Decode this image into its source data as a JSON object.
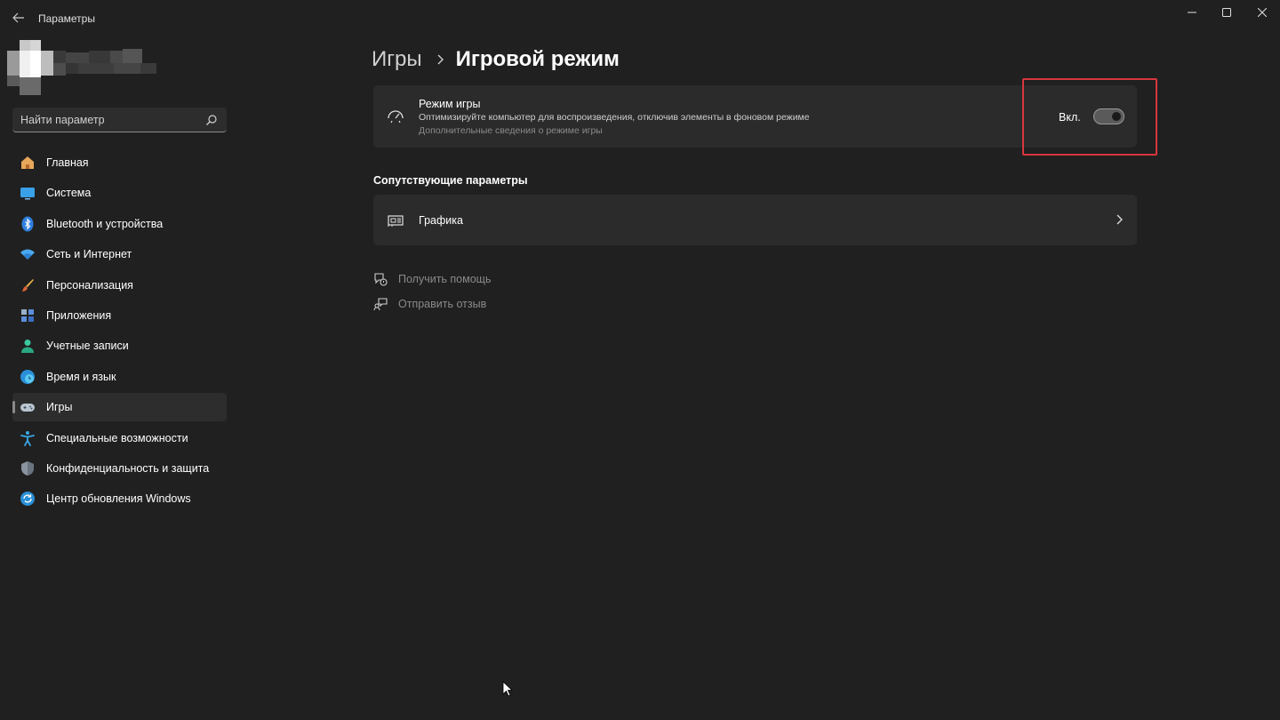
{
  "window": {
    "title": "Параметры",
    "controls": [
      "minimize-icon",
      "maximize-icon",
      "close-icon"
    ]
  },
  "search": {
    "placeholder": "Найти параметр"
  },
  "sidebar": {
    "items": [
      {
        "label": "Главная",
        "icon": "home-icon"
      },
      {
        "label": "Система",
        "icon": "system-icon"
      },
      {
        "label": "Bluetooth и устройства",
        "icon": "bluetooth-icon"
      },
      {
        "label": "Сеть и Интернет",
        "icon": "wifi-icon"
      },
      {
        "label": "Персонализация",
        "icon": "brush-icon"
      },
      {
        "label": "Приложения",
        "icon": "apps-icon"
      },
      {
        "label": "Учетные записи",
        "icon": "person-icon"
      },
      {
        "label": "Время и язык",
        "icon": "globe-clock-icon"
      },
      {
        "label": "Игры",
        "icon": "gamepad-icon",
        "active": true
      },
      {
        "label": "Специальные возможности",
        "icon": "accessibility-icon"
      },
      {
        "label": "Конфиденциальность и защита",
        "icon": "shield-icon"
      },
      {
        "label": "Центр обновления Windows",
        "icon": "update-icon"
      }
    ]
  },
  "breadcrumb": {
    "parent": "Игры",
    "current": "Игровой режим"
  },
  "game_mode": {
    "title": "Режим игры",
    "description": "Оптимизируйте компьютер для воспроизведения, отключив элементы в фоновом режиме",
    "more_info": "Дополнительные сведения о режиме игры",
    "toggle_label": "Вкл.",
    "toggle_on": true
  },
  "related": {
    "header": "Сопутствующие параметры",
    "items": [
      {
        "label": "Графика",
        "icon": "graphics-card-icon"
      }
    ]
  },
  "footer_links": {
    "help": "Получить помощь",
    "feedback": "Отправить отзыв"
  },
  "colors": {
    "background": "#202020",
    "card": "#2b2b2b",
    "highlight": "#d9363e",
    "accent_blue": "#4cc2ff"
  }
}
